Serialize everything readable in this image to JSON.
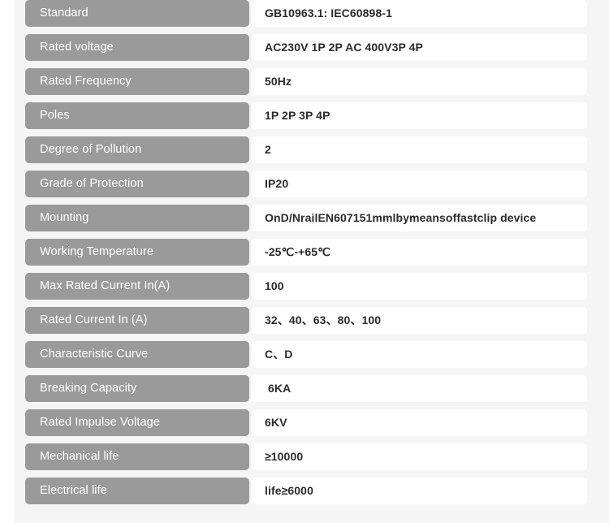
{
  "colors": {
    "page_background": "#f5f5f5",
    "label_pill": "#9a9a9a",
    "label_text": "#ffffff",
    "value_pill": "#ffffff",
    "value_text": "#2b2b2b"
  },
  "spec_table": {
    "rows": [
      {
        "label": "Standard",
        "value": "GB10963.1: IEC60898-1"
      },
      {
        "label": "Rated voltage",
        "value": "AC230V 1P 2P AC 400V3P 4P"
      },
      {
        "label": "Rated Frequency",
        "value": "50Hz"
      },
      {
        "label": "Poles",
        "value": "1P 2P 3P 4P"
      },
      {
        "label": "Degree of Pollution",
        "value": "2"
      },
      {
        "label": "Grade of Protection",
        "value": "IP20"
      },
      {
        "label": "Mounting",
        "value": "OnD/NrailEN607151mmlbymeansoffastclip device"
      },
      {
        "label": "Working Temperature",
        "value": "-25℃-+65℃"
      },
      {
        "label": "Max Rated Current In(A)",
        "value": "100"
      },
      {
        "label": "Rated Current In (A)",
        "value": "32、40、63、80、100"
      },
      {
        "label": "Characteristic Curve",
        "value": "C、D"
      },
      {
        "label": "Breaking Capacity",
        "value": " 6KA"
      },
      {
        "label": "Rated Impulse Voltage",
        "value": "6KV"
      },
      {
        "label": "Mechanical life",
        "value": "≥10000"
      },
      {
        "label": "Electrical life",
        "value": "life≥6000"
      }
    ]
  }
}
